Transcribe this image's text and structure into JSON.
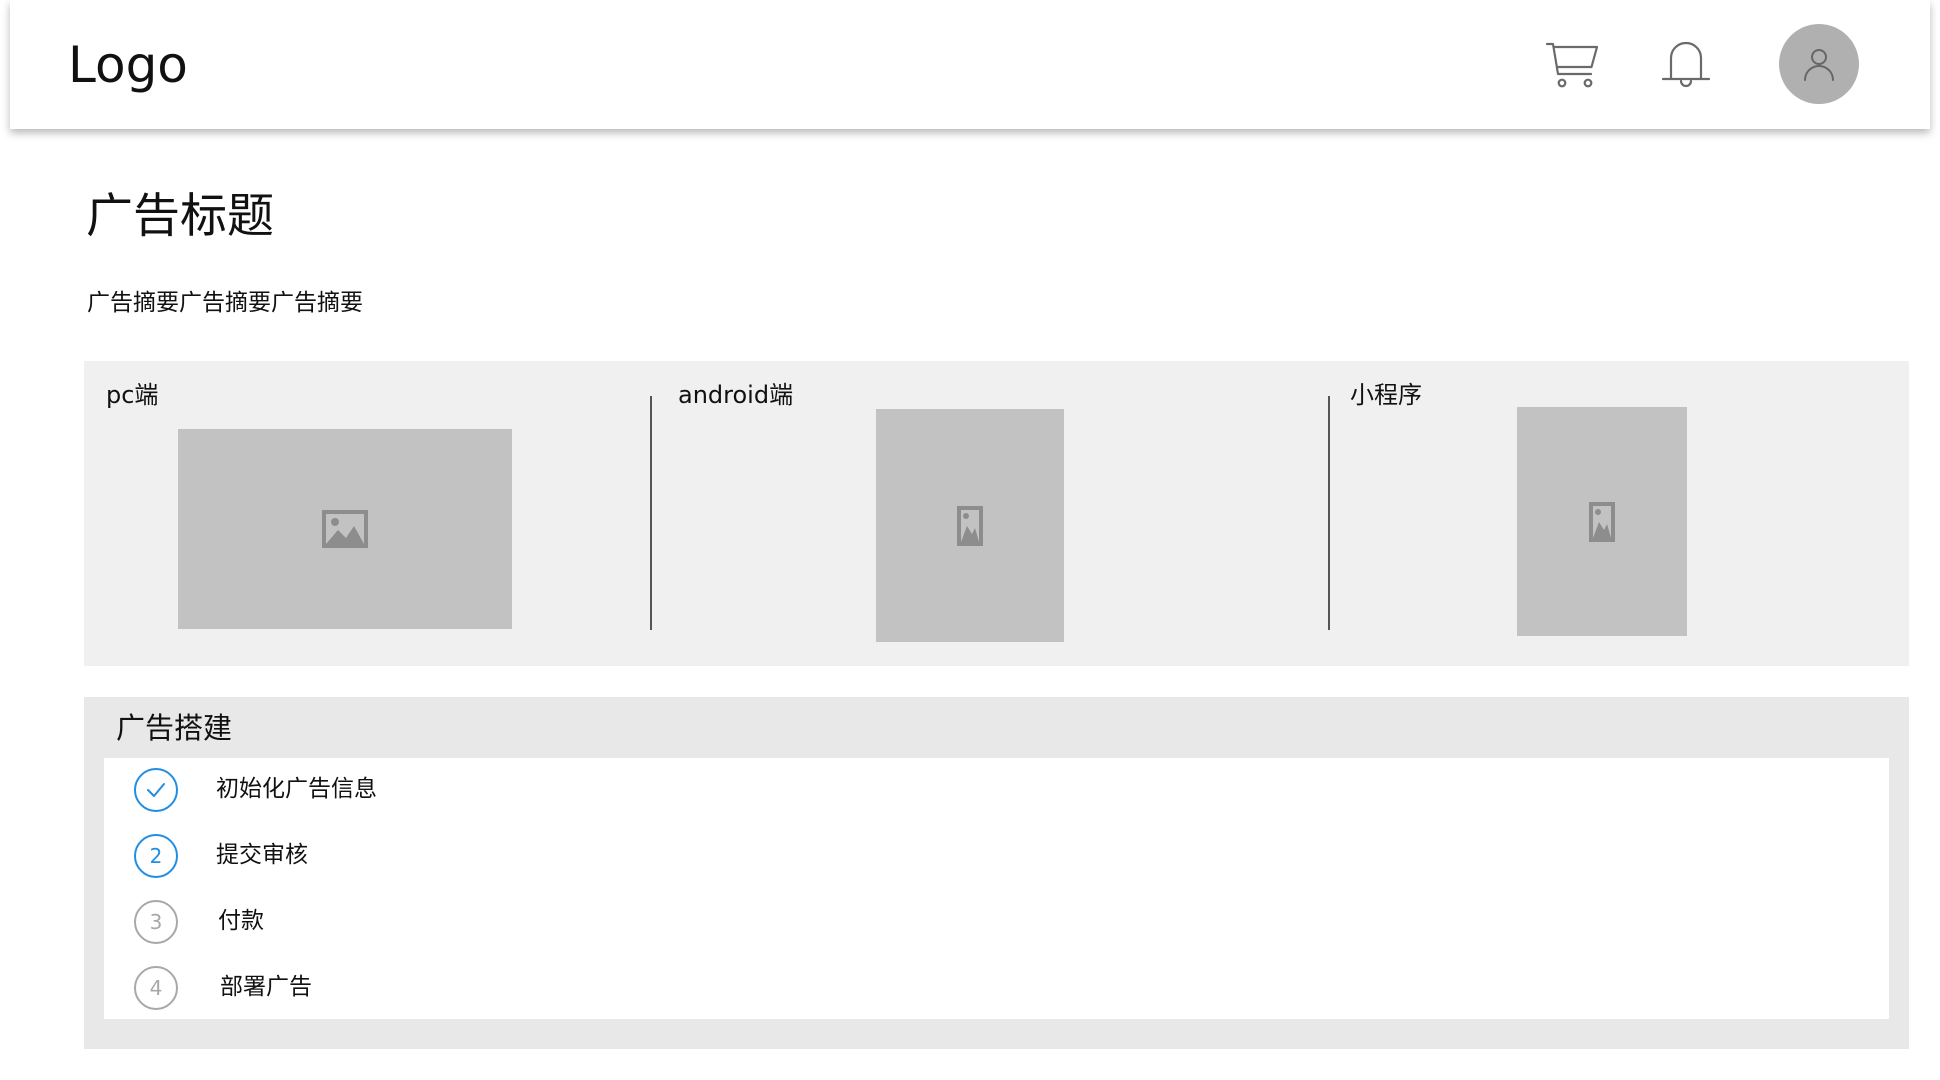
{
  "header": {
    "logo_text": "Logo",
    "icons": [
      "cart-icon",
      "bell-icon",
      "user-icon"
    ]
  },
  "ad": {
    "title": "广告标题",
    "summary": "广告摘要广告摘要广告摘要"
  },
  "platforms": [
    {
      "label": "pc端",
      "image_icon": "image-landscape-icon"
    },
    {
      "label": "android端",
      "image_icon": "image-portrait-icon"
    },
    {
      "label": "小程序",
      "image_icon": "image-portrait-icon"
    }
  ],
  "build": {
    "title": "广告搭建",
    "steps": [
      {
        "number": "",
        "label": "初始化广告信息",
        "status": "done"
      },
      {
        "number": "2",
        "label": "提交审核",
        "status": "current"
      },
      {
        "number": "3",
        "label": "付款",
        "status": "pending"
      },
      {
        "number": "4",
        "label": "部署广告",
        "status": "pending"
      }
    ]
  },
  "colors": {
    "accent": "#1f8ee3",
    "panel_bg": "#f0f0f0",
    "placeholder": "#c2c2c2",
    "avatar_bg": "#b0b0b0",
    "pending": "#a8a8a8"
  }
}
